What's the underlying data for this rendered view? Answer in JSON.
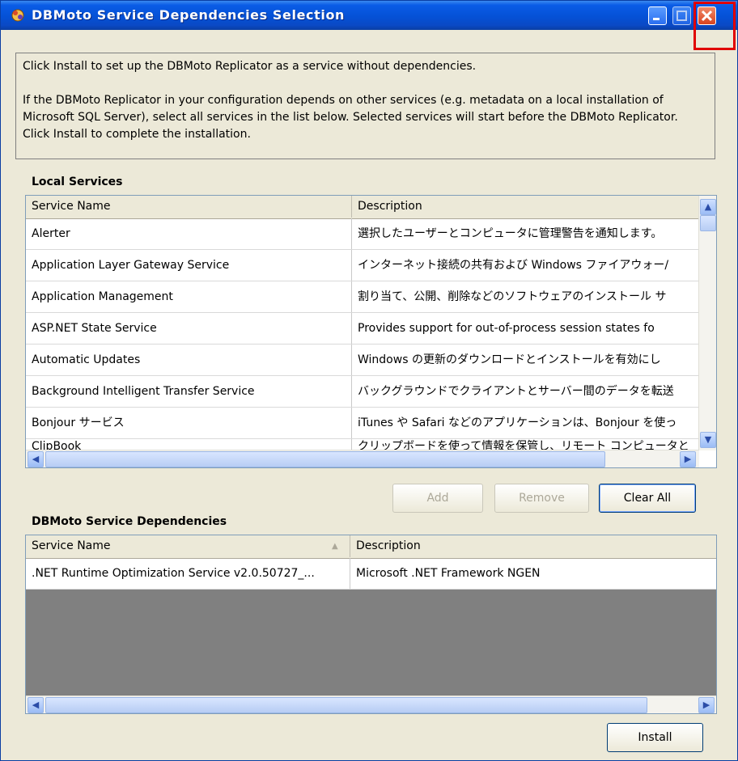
{
  "window": {
    "title": "DBMoto Service Dependencies Selection"
  },
  "info": {
    "line1": "Click Install to set up the DBMoto Replicator as a service without dependencies.",
    "line2": "If the DBMoto Replicator in your configuration depends on other services (e.g. metadata on a local installation of Microsoft SQL Server), select all services in the list below. Selected services will start before the DBMoto Replicator. Click Install to complete the installation."
  },
  "local_services": {
    "label": "Local Services",
    "columns": [
      "Service Name",
      "Description"
    ],
    "rows": [
      {
        "name": "Alerter",
        "desc": "選択したユーザーとコンピュータに管理警告を通知します。"
      },
      {
        "name": "Application Layer Gateway Service",
        "desc": "インターネット接続の共有および Windows ファイアウォー/"
      },
      {
        "name": "Application Management",
        "desc": "割り当て、公開、削除などのソフトウェアのインストール サ"
      },
      {
        "name": "ASP.NET State Service",
        "desc": "Provides support for out-of-process session states fo"
      },
      {
        "name": "Automatic Updates",
        "desc": "Windows の更新のダウンロードとインストールを有効にし"
      },
      {
        "name": "Background Intelligent Transfer Service",
        "desc": "バックグラウンドでクライアントとサーバー間のデータを転送"
      },
      {
        "name": "Bonjour サービス",
        "desc": "iTunes や Safari などのアプリケーションは、Bonjour を使っ"
      },
      {
        "name": "ClipBook",
        "desc": "クリップボードを使って情報を保管し、リモート コンピュータと"
      }
    ]
  },
  "buttons": {
    "add": "Add",
    "remove": "Remove",
    "clear_all": "Clear All",
    "install": "Install"
  },
  "dependencies": {
    "label": "DBMoto Service Dependencies",
    "columns": [
      "Service Name",
      "Description"
    ],
    "rows": [
      {
        "name": ".NET Runtime Optimization Service v2.0.50727_...",
        "desc": "Microsoft .NET Framework NGEN"
      }
    ]
  }
}
